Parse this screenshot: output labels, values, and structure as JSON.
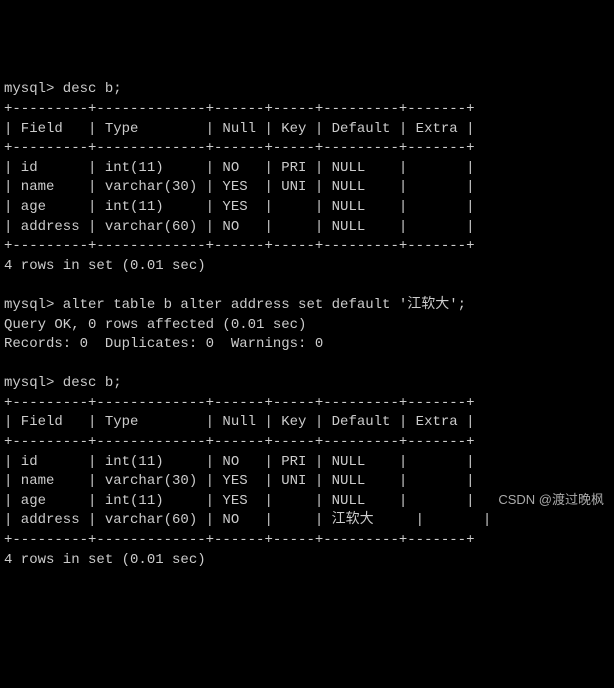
{
  "session": {
    "prompt": "mysql>",
    "cmd1": "desc b;",
    "table1": {
      "headers": [
        "Field",
        "Type",
        "Null",
        "Key",
        "Default",
        "Extra"
      ],
      "rows": [
        {
          "field": "id",
          "type": "int(11)",
          "null": "NO",
          "key": "PRI",
          "default": "NULL",
          "extra": ""
        },
        {
          "field": "name",
          "type": "varchar(30)",
          "null": "YES",
          "key": "UNI",
          "default": "NULL",
          "extra": ""
        },
        {
          "field": "age",
          "type": "int(11)",
          "null": "YES",
          "key": "",
          "default": "NULL",
          "extra": ""
        },
        {
          "field": "address",
          "type": "varchar(60)",
          "null": "NO",
          "key": "",
          "default": "NULL",
          "extra": ""
        }
      ],
      "footer": "4 rows in set (0.01 sec)"
    },
    "cmd2": "alter table b alter address set default '江软大';",
    "cmd2_result1": "Query OK, 0 rows affected (0.01 sec)",
    "cmd2_result2": "Records: 0  Duplicates: 0  Warnings: 0",
    "cmd3": "desc b;",
    "table2": {
      "headers": [
        "Field",
        "Type",
        "Null",
        "Key",
        "Default",
        "Extra"
      ],
      "rows": [
        {
          "field": "id",
          "type": "int(11)",
          "null": "NO",
          "key": "PRI",
          "default": "NULL",
          "extra": ""
        },
        {
          "field": "name",
          "type": "varchar(30)",
          "null": "YES",
          "key": "UNI",
          "default": "NULL",
          "extra": ""
        },
        {
          "field": "age",
          "type": "int(11)",
          "null": "YES",
          "key": "",
          "default": "NULL",
          "extra": ""
        },
        {
          "field": "address",
          "type": "varchar(60)",
          "null": "NO",
          "key": "",
          "default": "江软大",
          "extra": ""
        }
      ],
      "footer": "4 rows in set (0.01 sec)"
    }
  },
  "watermark": "CSDN @渡过晚枫"
}
